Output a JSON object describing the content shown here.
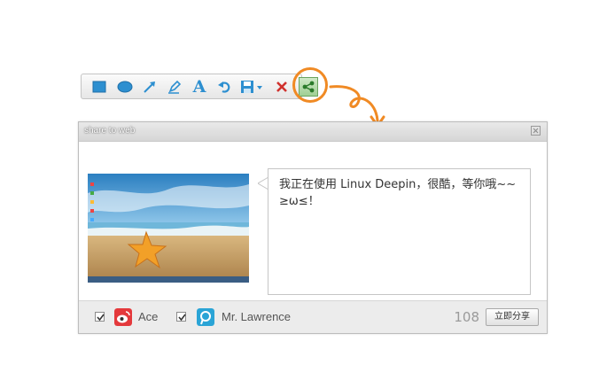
{
  "toolbar": {
    "tools": [
      {
        "icon": "rectangle-icon"
      },
      {
        "icon": "ellipse-icon"
      },
      {
        "icon": "arrow-icon"
      },
      {
        "icon": "pencil-icon"
      },
      {
        "icon": "text-icon",
        "glyph": "A"
      },
      {
        "icon": "undo-icon"
      },
      {
        "icon": "save-icon"
      },
      {
        "icon": "close-icon"
      },
      {
        "icon": "share-icon"
      }
    ],
    "accent": "#f08a24"
  },
  "dialog": {
    "title": "share to web",
    "message": "我正在使用 Linux Deepin，很酷，等你哦~~ ≥ω≤！",
    "accounts": [
      {
        "name": "Ace",
        "icon": "weibo-icon",
        "checked": true
      },
      {
        "name": "Mr. Lawrence",
        "icon": "tencent-weibo-icon",
        "checked": true
      }
    ],
    "char_count": "108",
    "share_label": "立即分享"
  }
}
